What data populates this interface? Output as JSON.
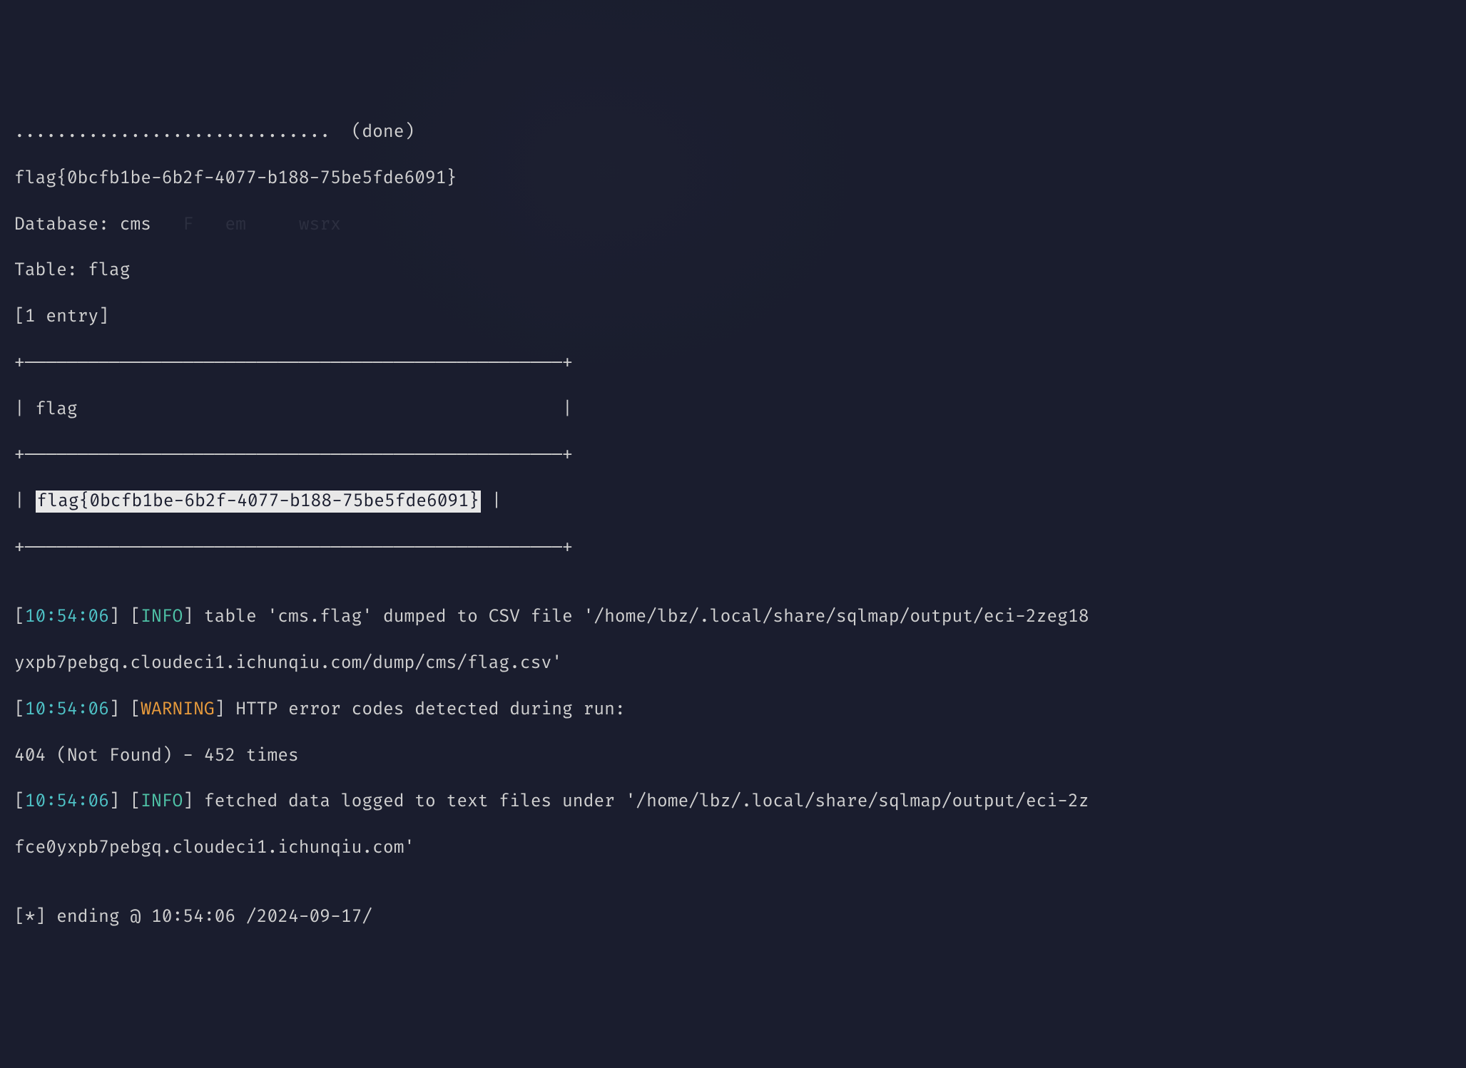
{
  "lines": {
    "dots_done": "..............................  (done)",
    "flag_raw": "flag{0bcfb1be-6b2f-4077-b188-75be5fde6091}",
    "database": "Database: cms",
    "table": "Table: flag",
    "entry_count": "[1 entry]",
    "table_border_top": "+———————————————————————————————————————————————————+",
    "table_header": "| flag                                              |",
    "table_border_mid": "+———————————————————————————————————————————————————+",
    "table_row_prefix": "| ",
    "table_row_flag": "flag{0bcfb1be-6b2f-4077-b188-75be5fde6091}",
    "table_row_suffix": " |",
    "table_border_bot": "+———————————————————————————————————————————————————+",
    "blank": "",
    "ts1": "10:54:06",
    "info_label": "INFO",
    "warning_label": "WARNING",
    "info1_text": " table 'cms.flag' dumped to CSV file '/home/lbz/.local/share/sqlmap/output/eci-2zeg18",
    "info1_cont": "yxpb7pebgq.cloudeci1.ichunqiu.com/dump/cms/flag.csv'",
    "warn_text": " HTTP error codes detected during run:",
    "err_404": "404 (Not Found) - 452 times",
    "info2_text": " fetched data logged to text files under '/home/lbz/.local/share/sqlmap/output/eci-2z",
    "info2_cont": "fce0yxpb7pebgq.cloudeci1.ichunqiu.com'",
    "ending": "[*] ending @ 10:54:06 /2024-09-17/",
    "ghost1": "F   em",
    "ghost2": "wsrx"
  }
}
